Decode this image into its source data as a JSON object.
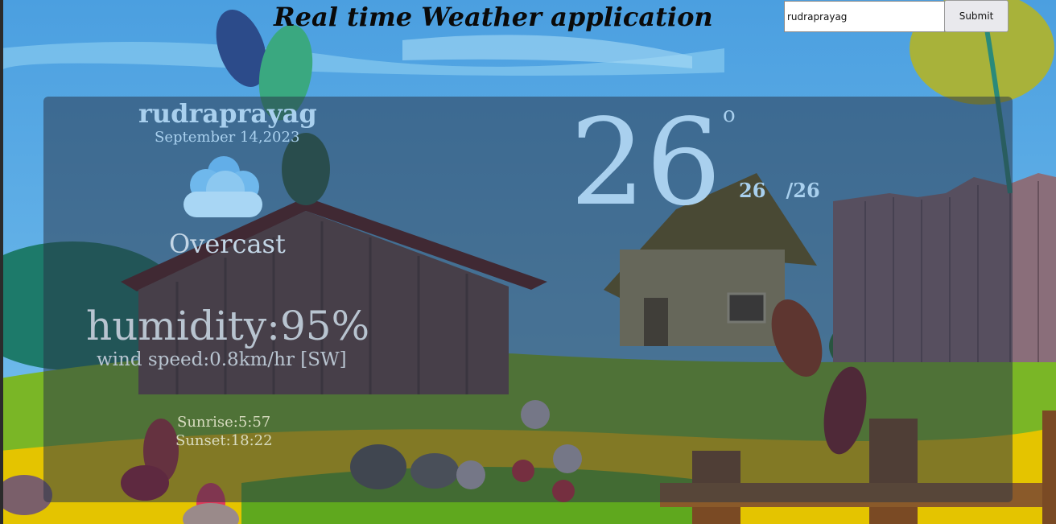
{
  "header": {
    "title": "Real time Weather application",
    "search_value": "rudraprayag",
    "submit_label": "Submit"
  },
  "weather": {
    "city": "rudraprayag",
    "date": "September 14,2023",
    "condition": "Overcast",
    "condition_icon": "cloud-icon",
    "temperature": "26",
    "degree_symbol": "o",
    "temp_min": "26",
    "temp_max": "/26",
    "humidity": "humidity:95%",
    "wind": "wind speed:0.8km/hr [SW]",
    "sunrise": "Sunrise:5:57",
    "sunset": "Sunset:18:22"
  },
  "colors": {
    "sky": "#5aa9e0",
    "card_overlay": "rgba(40,52,70,0.52)",
    "accent_text": "#a9d0ee"
  }
}
